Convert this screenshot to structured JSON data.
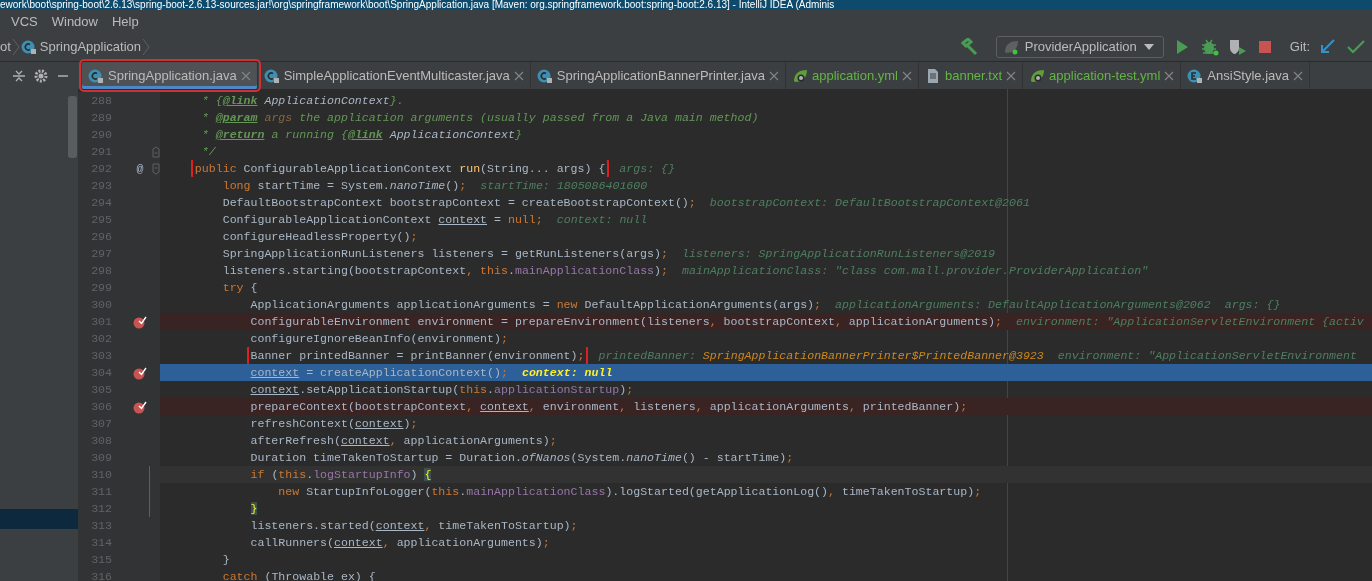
{
  "window": {
    "title": "ework\\boot\\spring-boot\\2.6.13\\spring-boot-2.6.13-sources.jar!\\org\\springframework\\boot\\SpringApplication.java [Maven: org.springframework.boot:spring-boot:2.6.13] - IntelliJ IDEA (Adminis"
  },
  "menu": [
    "VCS",
    "Window",
    "Help"
  ],
  "breadcrumb": [
    {
      "label": "ot"
    },
    {
      "label": "SpringApplication",
      "kind": "class"
    }
  ],
  "toolbar": {
    "run_config": "ProviderApplication",
    "git_label": "Git:"
  },
  "tabs": [
    {
      "label": "SpringApplication.java",
      "kind": "class",
      "selected": true,
      "annotated": true
    },
    {
      "label": "SimpleApplicationEventMulticaster.java",
      "kind": "class",
      "selected": false,
      "annotated": false
    },
    {
      "label": "SpringApplicationBannerPrinter.java",
      "kind": "class",
      "selected": false,
      "annotated": false
    },
    {
      "label": "application.yml",
      "kind": "spring",
      "selected": false,
      "annotated": false
    },
    {
      "label": "banner.txt",
      "kind": "text",
      "selected": false,
      "annotated": false
    },
    {
      "label": "application-test.yml",
      "kind": "spring",
      "selected": false,
      "annotated": false
    },
    {
      "label": "AnsiStyle.java",
      "kind": "enum",
      "selected": false,
      "annotated": false
    }
  ],
  "editor": {
    "lines": [
      {
        "number": "288",
        "breakpoint": false,
        "current": false,
        "code": [
          {
            "text": "     * {",
            "kind": "comment"
          },
          {
            "text": "@link",
            "kind": "tag"
          },
          {
            "text": " ApplicationContext",
            "kind": "docref"
          },
          {
            "text": "}.",
            "kind": "comment"
          }
        ]
      },
      {
        "number": "289",
        "breakpoint": false,
        "current": false,
        "code": [
          {
            "text": "     * ",
            "kind": "comment"
          },
          {
            "text": "@param",
            "kind": "tag"
          },
          {
            "text": " args",
            "kind": "param"
          },
          {
            "text": " the application arguments (usually passed from a Java main method)",
            "kind": "comment"
          }
        ]
      },
      {
        "number": "290",
        "breakpoint": false,
        "current": false,
        "code": [
          {
            "text": "     * ",
            "kind": "comment"
          },
          {
            "text": "@return",
            "kind": "tag"
          },
          {
            "text": " a running {",
            "kind": "comment"
          },
          {
            "text": "@link",
            "kind": "tag"
          },
          {
            "text": " ApplicationContext",
            "kind": "docref"
          },
          {
            "text": "}",
            "kind": "comment"
          }
        ]
      },
      {
        "number": "291",
        "breakpoint": false,
        "current": false,
        "fold_end": true,
        "code": [
          {
            "text": "     */",
            "kind": "comment"
          }
        ]
      },
      {
        "number": "292",
        "breakpoint": false,
        "current": false,
        "fold_start": true,
        "gutter_glyph": "@",
        "annotated": true,
        "code": [
          {
            "text": "    public",
            "kind": "keyword"
          },
          {
            "text": " ConfigurableApplicationContext ",
            "kind": "plain"
          },
          {
            "text": "run",
            "kind": "declaration"
          },
          {
            "text": "(String... args) {",
            "kind": "plain"
          }
        ],
        "hints": [
          {
            "name": "args:",
            "value": "{}",
            "changed": false
          }
        ]
      },
      {
        "number": "293",
        "breakpoint": false,
        "current": false,
        "code": [
          {
            "text": "        long",
            "kind": "keyword"
          },
          {
            "text": " startTime = System.",
            "kind": "plain"
          },
          {
            "text": "nanoTime",
            "kind": "static"
          },
          {
            "text": "()",
            "kind": "plain"
          },
          {
            "text": ";",
            "kind": "punct"
          }
        ],
        "hints": [
          {
            "name": "startTime:",
            "value": "1805086401600",
            "changed": false
          }
        ]
      },
      {
        "number": "294",
        "breakpoint": false,
        "current": false,
        "code": [
          {
            "text": "        DefaultBootstrapContext bootstrapContext = createBootstrapContext()",
            "kind": "plain"
          },
          {
            "text": ";",
            "kind": "punct"
          }
        ],
        "hints": [
          {
            "name": "bootstrapContext:",
            "value": "DefaultBootstrapContext@2061",
            "changed": false
          }
        ]
      },
      {
        "number": "295",
        "breakpoint": false,
        "current": false,
        "code": [
          {
            "text": "        ConfigurableApplicationContext ",
            "kind": "plain"
          },
          {
            "text": "context",
            "kind": "local"
          },
          {
            "text": " = ",
            "kind": "plain"
          },
          {
            "text": "null",
            "kind": "keyword"
          },
          {
            "text": ";",
            "kind": "punct"
          }
        ],
        "hints": [
          {
            "name": "context:",
            "value": "null",
            "changed": false
          }
        ]
      },
      {
        "number": "296",
        "breakpoint": false,
        "current": false,
        "code": [
          {
            "text": "        configureHeadlessProperty()",
            "kind": "plain"
          },
          {
            "text": ";",
            "kind": "punct"
          }
        ]
      },
      {
        "number": "297",
        "breakpoint": false,
        "current": false,
        "code": [
          {
            "text": "        SpringApplicationRunListeners listeners = getRunListeners(args)",
            "kind": "plain"
          },
          {
            "text": ";",
            "kind": "punct"
          }
        ],
        "hints": [
          {
            "name": "listeners:",
            "value": "SpringApplicationRunListeners@2019",
            "changed": false
          }
        ]
      },
      {
        "number": "298",
        "breakpoint": false,
        "current": false,
        "code": [
          {
            "text": "        listeners.starting(bootstrapContext",
            "kind": "plain"
          },
          {
            "text": ", ",
            "kind": "punct"
          },
          {
            "text": "this",
            "kind": "keyword"
          },
          {
            "text": ".",
            "kind": "plain"
          },
          {
            "text": "mainApplicationClass",
            "kind": "field"
          },
          {
            "text": ")",
            "kind": "plain"
          },
          {
            "text": ";",
            "kind": "punct"
          }
        ],
        "hints": [
          {
            "name": "mainApplicationClass:",
            "value": "\"class com.mall.provider.ProviderApplication\"",
            "changed": false
          }
        ]
      },
      {
        "number": "299",
        "breakpoint": false,
        "current": false,
        "code": [
          {
            "text": "        try",
            "kind": "keyword"
          },
          {
            "text": " {",
            "kind": "plain"
          }
        ]
      },
      {
        "number": "300",
        "breakpoint": false,
        "current": false,
        "code": [
          {
            "text": "            ApplicationArguments applicationArguments = ",
            "kind": "plain"
          },
          {
            "text": "new",
            "kind": "keyword"
          },
          {
            "text": " DefaultApplicationArguments(args)",
            "kind": "plain"
          },
          {
            "text": ";",
            "kind": "punct"
          }
        ],
        "hints": [
          {
            "name": "applicationArguments:",
            "value": "DefaultApplicationArguments@2062",
            "changed": false
          },
          {
            "name": "args:",
            "value": "{}",
            "changed": false
          }
        ]
      },
      {
        "number": "301",
        "breakpoint": true,
        "current": false,
        "code": [
          {
            "text": "            ConfigurableEnvironment environment = prepareEnvironment(listeners",
            "kind": "plain"
          },
          {
            "text": ", ",
            "kind": "punct"
          },
          {
            "text": "bootstrapContext",
            "kind": "plain"
          },
          {
            "text": ", ",
            "kind": "punct"
          },
          {
            "text": "applicationArguments)",
            "kind": "plain"
          },
          {
            "text": ";",
            "kind": "punct"
          }
        ],
        "hints": [
          {
            "name": "environment:",
            "value": "\"ApplicationServletEnvironment {activ",
            "changed": false
          }
        ]
      },
      {
        "number": "302",
        "breakpoint": false,
        "current": false,
        "code": [
          {
            "text": "            configureIgnoreBeanInfo(environment)",
            "kind": "plain"
          },
          {
            "text": ";",
            "kind": "punct"
          }
        ]
      },
      {
        "number": "303",
        "breakpoint": false,
        "current": false,
        "annotated": true,
        "code": [
          {
            "text": "            Banner printedBanner = printBanner(environment)",
            "kind": "plain"
          },
          {
            "text": ";",
            "kind": "punct"
          }
        ],
        "hints": [
          {
            "name": "printedBanner:",
            "value": "SpringApplicationBannerPrinter$PrintedBanner@3923",
            "changed": true
          },
          {
            "name": "environment:",
            "value": "\"ApplicationServletEnvironment",
            "changed": false
          }
        ]
      },
      {
        "number": "304",
        "breakpoint": true,
        "current": true,
        "code": [
          {
            "text": "            context",
            "kind": "local"
          },
          {
            "text": " = createApplicationContext()",
            "kind": "plain"
          },
          {
            "text": ";",
            "kind": "punct"
          }
        ],
        "hints": [
          {
            "name": "context:",
            "value": "null",
            "changed": false
          }
        ]
      },
      {
        "number": "305",
        "breakpoint": false,
        "current": false,
        "code": [
          {
            "text": "            context",
            "kind": "local"
          },
          {
            "text": ".setApplicationStartup(",
            "kind": "plain"
          },
          {
            "text": "this",
            "kind": "keyword"
          },
          {
            "text": ".",
            "kind": "plain"
          },
          {
            "text": "applicationStartup",
            "kind": "field"
          },
          {
            "text": ")",
            "kind": "plain"
          },
          {
            "text": ";",
            "kind": "punct"
          }
        ]
      },
      {
        "number": "306",
        "breakpoint": true,
        "current": false,
        "code": [
          {
            "text": "            prepareContext(bootstrapContext",
            "kind": "plain"
          },
          {
            "text": ", ",
            "kind": "punct"
          },
          {
            "text": "context",
            "kind": "local"
          },
          {
            "text": ", ",
            "kind": "punct"
          },
          {
            "text": "environment",
            "kind": "plain"
          },
          {
            "text": ", ",
            "kind": "punct"
          },
          {
            "text": "listeners",
            "kind": "plain"
          },
          {
            "text": ", ",
            "kind": "punct"
          },
          {
            "text": "applicationArguments",
            "kind": "plain"
          },
          {
            "text": ", ",
            "kind": "punct"
          },
          {
            "text": "printedBanner)",
            "kind": "plain"
          },
          {
            "text": ";",
            "kind": "punct"
          }
        ]
      },
      {
        "number": "307",
        "breakpoint": false,
        "current": false,
        "code": [
          {
            "text": "            refreshContext(",
            "kind": "plain"
          },
          {
            "text": "context",
            "kind": "local"
          },
          {
            "text": ")",
            "kind": "plain"
          },
          {
            "text": ";",
            "kind": "punct"
          }
        ]
      },
      {
        "number": "308",
        "breakpoint": false,
        "current": false,
        "code": [
          {
            "text": "            afterRefresh(",
            "kind": "plain"
          },
          {
            "text": "context",
            "kind": "local"
          },
          {
            "text": ", ",
            "kind": "punct"
          },
          {
            "text": "applicationArguments)",
            "kind": "plain"
          },
          {
            "text": ";",
            "kind": "punct"
          }
        ]
      },
      {
        "number": "309",
        "breakpoint": false,
        "current": false,
        "code": [
          {
            "text": "            Duration timeTakenToStartup = Duration.",
            "kind": "plain"
          },
          {
            "text": "ofNanos",
            "kind": "static"
          },
          {
            "text": "(System.",
            "kind": "plain"
          },
          {
            "text": "nanoTime",
            "kind": "static"
          },
          {
            "text": "() - startTime)",
            "kind": "plain"
          },
          {
            "text": ";",
            "kind": "punct"
          }
        ]
      },
      {
        "number": "310",
        "breakpoint": false,
        "current": false,
        "caret_line": true,
        "modified": true,
        "code": [
          {
            "text": "            if",
            "kind": "keyword"
          },
          {
            "text": " (",
            "kind": "plain"
          },
          {
            "text": "this",
            "kind": "keyword"
          },
          {
            "text": ".",
            "kind": "plain"
          },
          {
            "text": "logStartupInfo",
            "kind": "field"
          },
          {
            "text": ") ",
            "kind": "plain"
          },
          {
            "text": "{",
            "kind": "brace"
          }
        ]
      },
      {
        "number": "311",
        "breakpoint": false,
        "current": false,
        "modified": true,
        "code": [
          {
            "text": "                new",
            "kind": "keyword"
          },
          {
            "text": " StartupInfoLogger(",
            "kind": "plain"
          },
          {
            "text": "this",
            "kind": "keyword"
          },
          {
            "text": ".",
            "kind": "plain"
          },
          {
            "text": "mainApplicationClass",
            "kind": "field"
          },
          {
            "text": ").logStarted(getApplicationLog()",
            "kind": "plain"
          },
          {
            "text": ", ",
            "kind": "punct"
          },
          {
            "text": "timeTakenToStartup)",
            "kind": "plain"
          },
          {
            "text": ";",
            "kind": "punct"
          }
        ]
      },
      {
        "number": "312",
        "breakpoint": false,
        "current": false,
        "modified": true,
        "code": [
          {
            "text": "            }",
            "kind": "brace"
          }
        ]
      },
      {
        "number": "313",
        "breakpoint": false,
        "current": false,
        "code": [
          {
            "text": "            listeners.started(",
            "kind": "plain"
          },
          {
            "text": "context",
            "kind": "local"
          },
          {
            "text": ", ",
            "kind": "punct"
          },
          {
            "text": "timeTakenToStartup)",
            "kind": "plain"
          },
          {
            "text": ";",
            "kind": "punct"
          }
        ]
      },
      {
        "number": "314",
        "breakpoint": false,
        "current": false,
        "code": [
          {
            "text": "            callRunners(",
            "kind": "plain"
          },
          {
            "text": "context",
            "kind": "local"
          },
          {
            "text": ", ",
            "kind": "punct"
          },
          {
            "text": "applicationArguments)",
            "kind": "plain"
          },
          {
            "text": ";",
            "kind": "punct"
          }
        ]
      },
      {
        "number": "315",
        "breakpoint": false,
        "current": false,
        "code": [
          {
            "text": "        }",
            "kind": "plain"
          }
        ]
      },
      {
        "number": "316",
        "breakpoint": false,
        "current": false,
        "code": [
          {
            "text": "        catch",
            "kind": "keyword"
          },
          {
            "text": " (Throwable ex) {",
            "kind": "plain"
          }
        ]
      }
    ]
  }
}
